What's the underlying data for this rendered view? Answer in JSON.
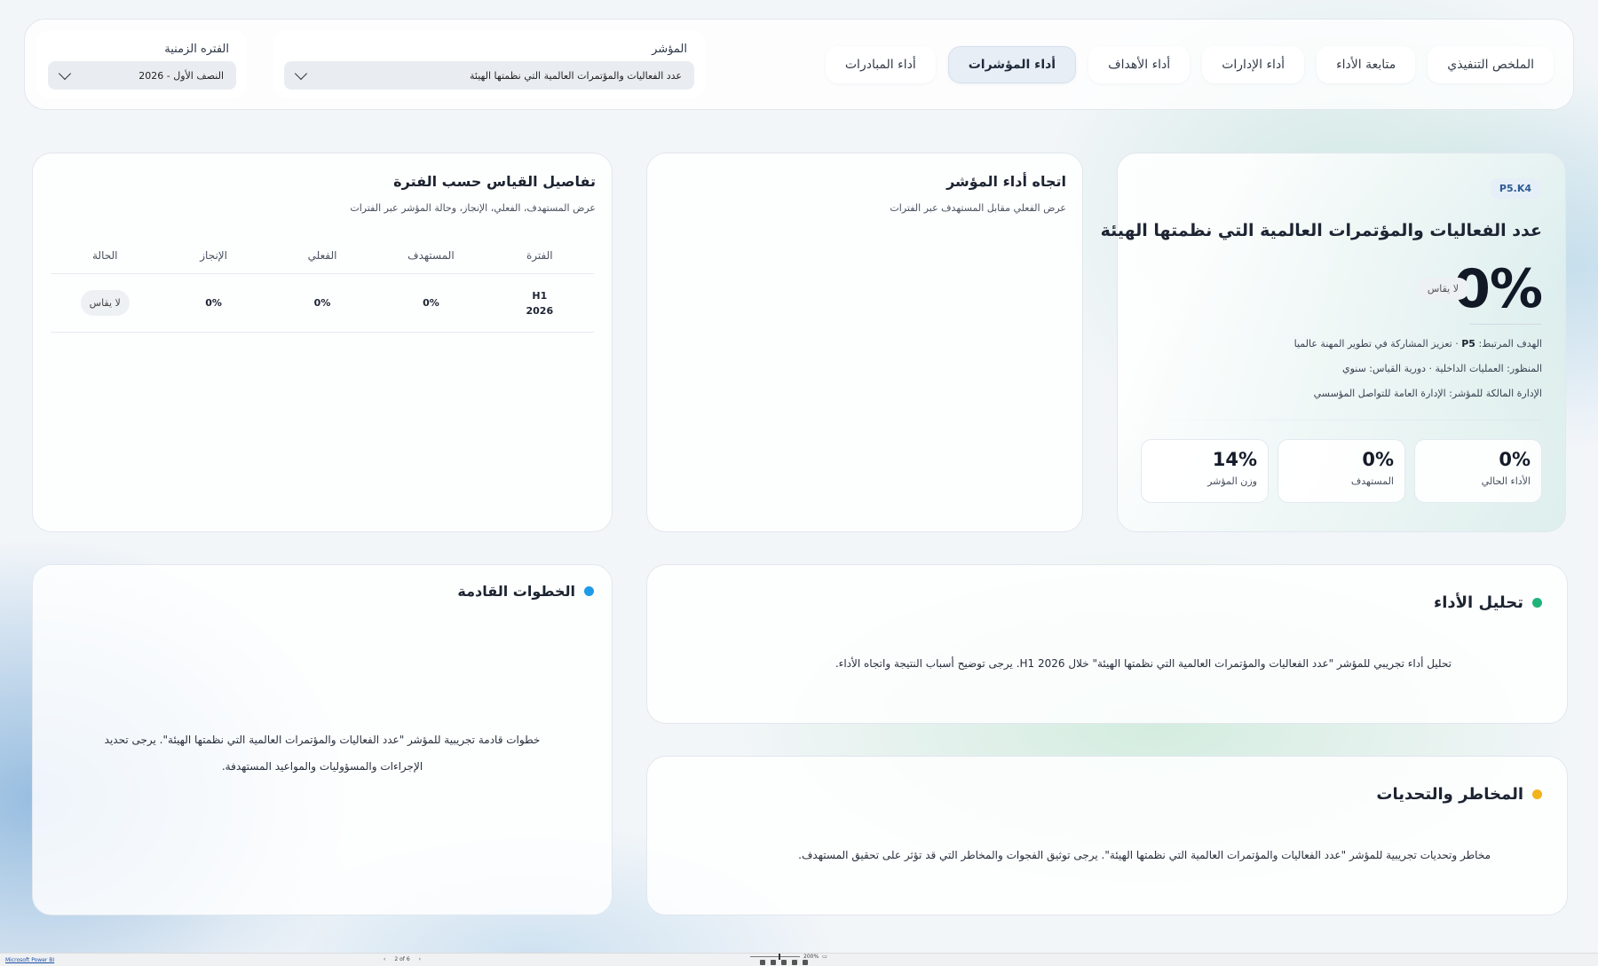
{
  "tabs": [
    {
      "label": "الملخص التنفيذي"
    },
    {
      "label": "متابعة الأداء"
    },
    {
      "label": "أداء الإدارات"
    },
    {
      "label": "أداء الأهداف"
    },
    {
      "label": "أداء المؤشرات",
      "active": true
    },
    {
      "label": "أداء المبادرات"
    }
  ],
  "filters": {
    "indicator": {
      "label": "المؤشر",
      "value": "عدد الفعاليات والمؤتمرات العالمية التي نظمتها الهيئة"
    },
    "period": {
      "label": "الفتره الزمنية",
      "value": "النصف الأول - 2026"
    }
  },
  "kpi": {
    "code": "P5.K4",
    "title": "عدد الفعاليات والمؤتمرات العالمية التي نظمتها الهيئة",
    "value": "0%",
    "status": "لا يقاس",
    "goal_label": "الهدف المرتبط:",
    "goal_code": "P5",
    "goal_text": "· تعزيز المشاركة في تطوير المهنة عالميا",
    "perspective": "المنظور: العمليات الداخلية · دورية القياس: سنوي",
    "owner": "الإدارة المالكة للمؤشر: الإدارة العامة للتواصل المؤسسي",
    "stats": [
      {
        "value": "0%",
        "label": "الأداء الحالي"
      },
      {
        "value": "0%",
        "label": "المستهدف"
      },
      {
        "value": "14%",
        "label": "وزن المؤشر"
      }
    ]
  },
  "trend": {
    "title": "اتجاه أداء المؤشر",
    "subtitle": "عرض الفعلي مقابل المستهدف عبر الفترات"
  },
  "details": {
    "title": "تفاصيل القياس حسب الفترة",
    "subtitle": "عرض المستهدف، الفعلي، الإنجاز، وحالة المؤشر عبر الفترات",
    "columns": [
      "الفترة",
      "المستهدف",
      "الفعلي",
      "الإنجاز",
      "الحالة"
    ],
    "rows": [
      {
        "period_line1": "H1",
        "period_line2": "2026",
        "target": "0%",
        "actual": "0%",
        "achievement": "0%",
        "status": "لا يقاس"
      }
    ]
  },
  "analysis": {
    "title": "تحليل الأداء",
    "dot_color": "#1fb37a",
    "body": "تحليل أداء تجريبي للمؤشر \"عدد الفعاليات والمؤتمرات العالمية التي نظمتها الهيئة\" خلال H1 2026. يرجى توضيح أسباب النتيجة واتجاه الأداء."
  },
  "risks": {
    "title": "المخاطر والتحديات",
    "dot_color": "#f2b41c",
    "body": "مخاطر وتحديات تجريبية للمؤشر \"عدد الفعاليات والمؤتمرات العالمية التي نظمتها الهيئة\". يرجى توثيق الفجوات والمخاطر التي قد تؤثر على تحقيق المستهدف."
  },
  "next_steps": {
    "title": "الخطوات القادمة",
    "dot_color": "#1e9be8",
    "body_line1": "خطوات قادمة تجريبية للمؤشر \"عدد الفعاليات والمؤتمرات العالمية التي نظمتها الهيئة\". يرجى تحديد",
    "body_line2": "الإجراءات والمسؤوليات والمواعيد المستهدفة."
  },
  "footer": {
    "app_link": "Microsoft Power BI",
    "page_indicator": "2 of 6",
    "prev": "‹",
    "next": "›",
    "zoom": "200%"
  }
}
